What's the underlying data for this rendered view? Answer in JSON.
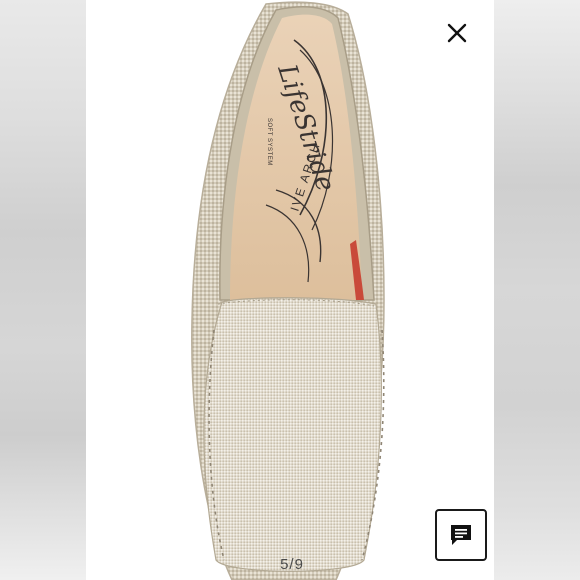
{
  "viewer": {
    "counter": "5/9",
    "close_icon": "close-icon",
    "chat_icon": "chat-icon"
  },
  "product_image": {
    "brand_logo": "LifeStride",
    "brand_tagline": "SOFT SYSTEM",
    "insole_print": "IVE ARCH"
  },
  "colors": {
    "shoe_metallic": "#cfc6b4",
    "insole": "#e4c7a8",
    "background": "#ffffff",
    "icon": "#111111"
  }
}
